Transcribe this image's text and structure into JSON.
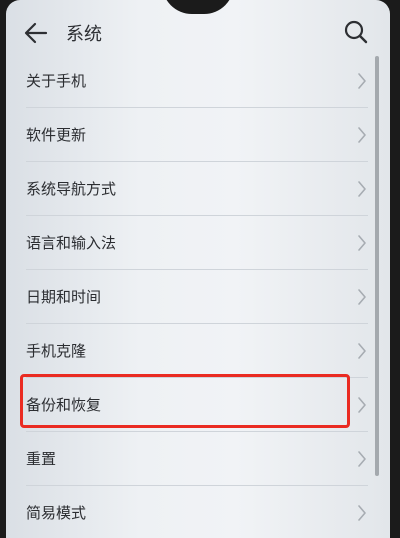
{
  "header": {
    "title": "系统",
    "back_icon": "arrow-left-icon",
    "search_icon": "search-icon"
  },
  "menu_items": [
    {
      "label": "关于手机",
      "chevron": "chevron-right-icon"
    },
    {
      "label": "软件更新",
      "chevron": "chevron-right-icon"
    },
    {
      "label": "系统导航方式",
      "chevron": "chevron-right-icon"
    },
    {
      "label": "语言和输入法",
      "chevron": "chevron-right-icon"
    },
    {
      "label": "日期和时间",
      "chevron": "chevron-right-icon"
    },
    {
      "label": "手机克隆",
      "chevron": "chevron-right-icon"
    },
    {
      "label": "备份和恢复",
      "chevron": "chevron-right-icon",
      "highlighted": true
    },
    {
      "label": "重置",
      "chevron": "chevron-right-icon"
    },
    {
      "label": "简易模式",
      "chevron": "chevron-right-icon"
    }
  ],
  "colors": {
    "highlight": "#ea2b22",
    "text": "#2b2d31",
    "chevron": "#a7acb2"
  }
}
